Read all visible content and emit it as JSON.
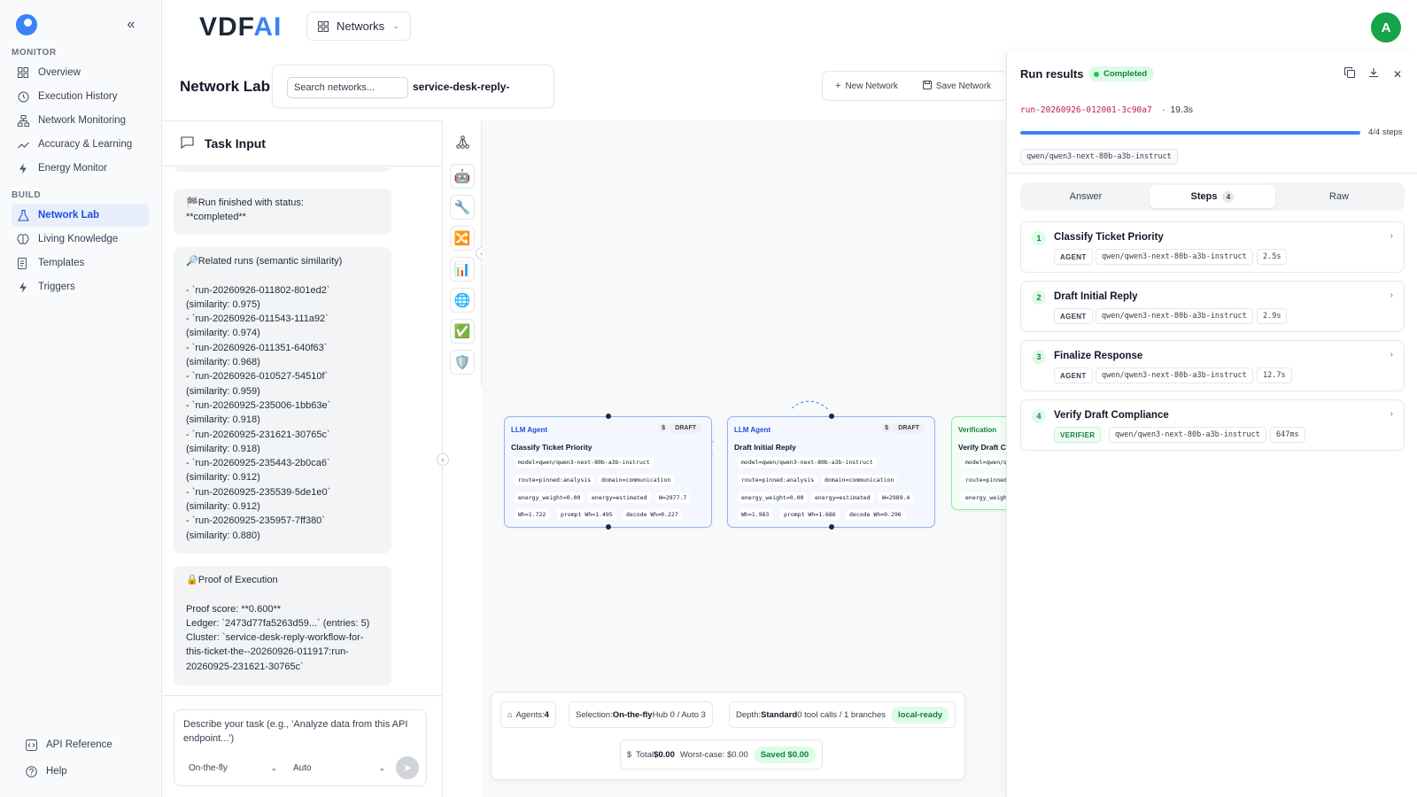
{
  "sidebar": {
    "monitor_label": "MONITOR",
    "build_label": "BUILD",
    "monitor_items": [
      {
        "label": "Overview",
        "icon": "grid-icon"
      },
      {
        "label": "Execution History",
        "icon": "history-icon"
      },
      {
        "label": "Network Monitoring",
        "icon": "network-icon"
      },
      {
        "label": "Accuracy & Learning",
        "icon": "trend-icon"
      },
      {
        "label": "Energy Monitor",
        "icon": "bolt-icon"
      }
    ],
    "build_items": [
      {
        "label": "Network Lab",
        "icon": "flask-icon",
        "active": true
      },
      {
        "label": "Living Knowledge",
        "icon": "brain-icon"
      },
      {
        "label": "Templates",
        "icon": "document-icon"
      },
      {
        "label": "Triggers",
        "icon": "bolt-icon"
      }
    ],
    "footer_items": [
      {
        "label": "API Reference",
        "icon": "code-icon"
      },
      {
        "label": "Help",
        "icon": "help-icon"
      }
    ]
  },
  "topbar": {
    "brand_main": "VDF",
    "brand_accent": "AI",
    "networks_label": "Networks",
    "avatar_initial": "A"
  },
  "page": {
    "title": "Network Lab",
    "search_placeholder": "Search networks...",
    "current_network": "service-desk-reply-",
    "new_network_label": "New Network",
    "save_network_label": "Save Network"
  },
  "task": {
    "header": "Task Input",
    "messages": [
      "🏁Run finished with status:\n**completed**",
      "🔎Related runs (semantic similarity)\n\n- `run-20260926-011802-801ed2`\n(similarity: 0.975)\n- `run-20260926-011543-111a92`\n(similarity: 0.974)\n- `run-20260926-011351-640f63`\n(similarity: 0.968)\n- `run-20260926-010527-54510f`\n(similarity: 0.959)\n- `run-20260925-235006-1bb63e`\n(similarity: 0.918)\n- `run-20260925-231621-30765c`\n(similarity: 0.918)\n- `run-20260925-235443-2b0ca6`\n(similarity: 0.912)\n- `run-20260925-235539-5de1e0`\n(similarity: 0.912)\n- `run-20260925-235957-7ff380`\n(similarity: 0.880)",
      "🔒Proof of Execution\n\nProof score: **0.600**\nLedger: `2473d77fa5263d59...` (entries: 5)\nCluster: `service-desk-reply-workflow-for-\nthis-ticket-the--20260926-011917:run-\n20260925-231621-30765c`"
    ],
    "composer_placeholder": "Describe your task (e.g., 'Analyze data from this API endpoint...')",
    "mode_select": "On-the-fly",
    "model_select": "Auto"
  },
  "tools": [
    "hierarchy-icon",
    "robot-icon",
    "wrench-icon",
    "shuffle-icon",
    "bar-chart-icon",
    "globe-icon",
    "check-icon",
    "shield-icon"
  ],
  "canvas": {
    "nodes": [
      {
        "kind": "LLM Agent",
        "title": "Classify Ticket Priority",
        "badge": "DRAFT",
        "dollar": "$",
        "model": "model=qwen/qwen3-next-80b-a3b-instruct",
        "route": "route=pinned:analysis",
        "domain": "domain=communication",
        "energy_weight": "energy_weight=0.00",
        "energy": "energy=estimated",
        "w": "W=2977.7",
        "wh": "Wh=1.722",
        "prompt_wh": "prompt Wh=1.495",
        "decode_wh": "decode Wh=0.227"
      },
      {
        "kind": "LLM Agent",
        "title": "Draft Initial Reply",
        "badge": "DRAFT",
        "dollar": "$",
        "model": "model=qwen/qwen3-next-80b-a3b-instruct",
        "route": "route=pinned:analysis",
        "domain": "domain=communication",
        "energy_weight": "energy_weight=0.00",
        "energy": "energy=estimated",
        "w": "W=2989.4",
        "wh": "Wh=1.983",
        "prompt_wh": "prompt Wh=1.686",
        "decode_wh": "decode Wh=0.296"
      },
      {
        "kind": "Verification",
        "title": "Verify Draft C",
        "model": "model=qwen/q",
        "route": "route=pinned",
        "energy_weight": "energy_weigh"
      }
    ],
    "stats": {
      "agents_label": "Agents:",
      "agents_value": "4",
      "selection_label": "Selection:",
      "selection_value": "On-the-fly",
      "selection_rest": "Hub 0 / Auto 3",
      "depth_label": "Depth:",
      "depth_value": "Standard",
      "depth_rest": "0 tool calls / 1 branches",
      "ready_badge": "local-ready",
      "total_label": "Total",
      "total_value": "$0.00",
      "worst_case": "Worst-case: $0.00",
      "saved": "Saved $0.00"
    }
  },
  "results": {
    "title": "Run results",
    "status": "Completed",
    "run_id": "run-20260926-012001-3c90a7",
    "separator": "·",
    "duration": "19.3s",
    "progress_fraction": 1.0,
    "steps_progress": "4/4 steps",
    "model": "qwen/qwen3-next-80b-a3b-instruct",
    "tabs": {
      "answer": "Answer",
      "steps": "Steps",
      "steps_count": "4",
      "raw": "Raw"
    },
    "steps": [
      {
        "num": "1",
        "title": "Classify Ticket Priority",
        "kind": "AGENT",
        "model": "qwen/qwen3-next-80b-a3b-instruct",
        "time": "2.5s"
      },
      {
        "num": "2",
        "title": "Draft Initial Reply",
        "kind": "AGENT",
        "model": "qwen/qwen3-next-80b-a3b-instruct",
        "time": "2.9s"
      },
      {
        "num": "3",
        "title": "Finalize Response",
        "kind": "AGENT",
        "model": "qwen/qwen3-next-80b-a3b-instruct",
        "time": "12.7s"
      },
      {
        "num": "4",
        "title": "Verify Draft Compliance",
        "kind": "VERIFIER",
        "model": "qwen/qwen3-next-80b-a3b-instruct",
        "time": "647ms"
      }
    ]
  },
  "colors": {
    "accent": "#3b82f6",
    "success": "#16a34a",
    "run_id": "#be185d"
  }
}
